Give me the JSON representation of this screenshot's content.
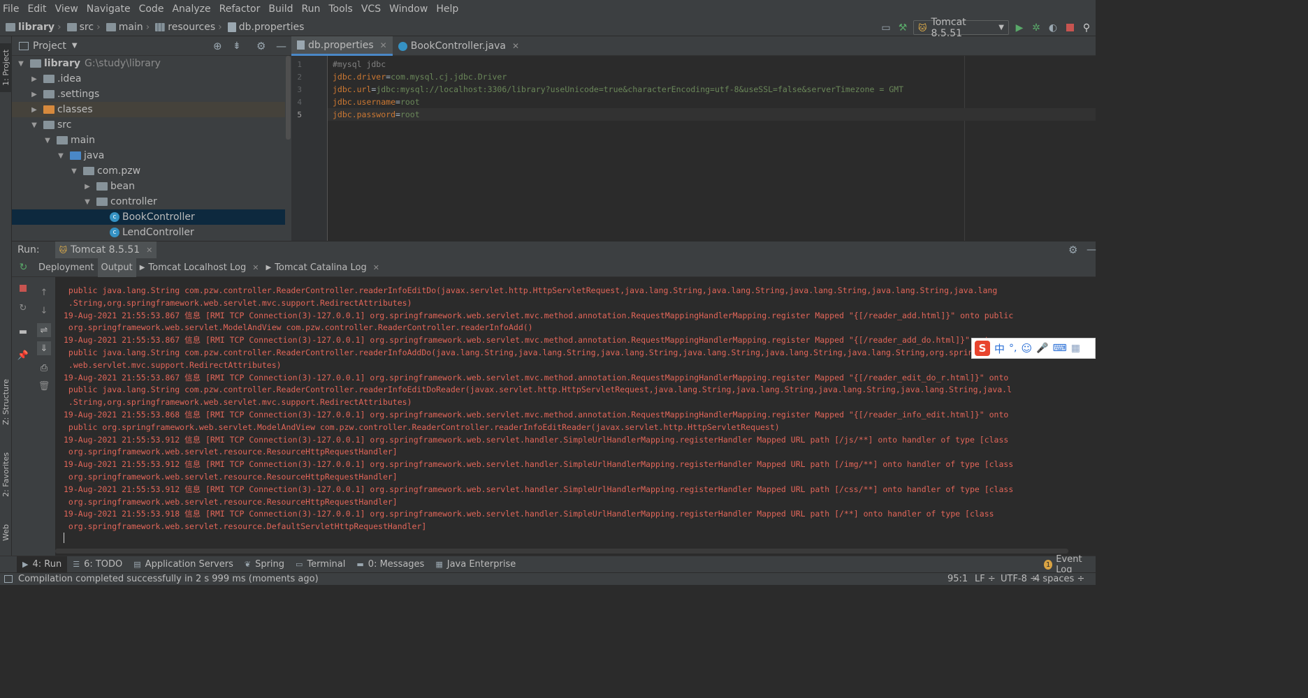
{
  "menu": [
    "File",
    "Edit",
    "View",
    "Navigate",
    "Code",
    "Analyze",
    "Refactor",
    "Build",
    "Run",
    "Tools",
    "VCS",
    "Window",
    "Help"
  ],
  "breadcrumb": [
    "library",
    "src",
    "main",
    "resources",
    "db.properties"
  ],
  "run_config": {
    "label": "Tomcat 8.5.51"
  },
  "side_tabs": {
    "project": "1: Project",
    "structure": "Z: Structure",
    "favorites": "2: Favorites",
    "web": "Web"
  },
  "project": {
    "title": "Project",
    "tree": [
      {
        "label": "library",
        "path": "G:\\study\\library",
        "kind": "module",
        "expanded": true,
        "indent": 0
      },
      {
        "label": ".idea",
        "kind": "folder",
        "expanded": false,
        "indent": 1
      },
      {
        "label": ".settings",
        "kind": "folder",
        "expanded": false,
        "indent": 1
      },
      {
        "label": "classes",
        "kind": "folder-excluded",
        "expanded": false,
        "indent": 1
      },
      {
        "label": "src",
        "kind": "folder",
        "expanded": true,
        "indent": 1
      },
      {
        "label": "main",
        "kind": "folder",
        "expanded": true,
        "indent": 2
      },
      {
        "label": "java",
        "kind": "folder-source",
        "expanded": true,
        "indent": 3
      },
      {
        "label": "com.pzw",
        "kind": "package",
        "expanded": true,
        "indent": 4
      },
      {
        "label": "bean",
        "kind": "package",
        "expanded": false,
        "indent": 5
      },
      {
        "label": "controller",
        "kind": "package",
        "expanded": true,
        "indent": 5
      },
      {
        "label": "BookController",
        "kind": "class",
        "selected": true,
        "indent": 6
      },
      {
        "label": "LendController",
        "kind": "class",
        "indent": 6
      }
    ]
  },
  "editor": {
    "tabs": [
      {
        "label": "db.properties",
        "active": true
      },
      {
        "label": "BookController.java",
        "active": false
      }
    ],
    "lines": [
      {
        "no": "1",
        "key": "#mysql jdbc",
        "value": "",
        "comment": true
      },
      {
        "no": "2",
        "key": "jdbc.driver",
        "value": "com.mysql.cj.jdbc.Driver"
      },
      {
        "no": "3",
        "key": "jdbc.url",
        "value": "jdbc:mysql://localhost:3306/library?useUnicode=true&characterEncoding=utf-8&useSSL=false&serverTimezone = GMT"
      },
      {
        "no": "4",
        "key": "jdbc.username",
        "value": "root"
      },
      {
        "no": "5",
        "key": "jdbc.password",
        "value": "root",
        "current": true
      }
    ]
  },
  "run": {
    "label": "Run:",
    "config_tab": "Tomcat 8.5.51",
    "tabs": [
      "Deployment",
      "Output",
      "Tomcat Localhost Log",
      "Tomcat Catalina Log"
    ],
    "active_tab": "Output",
    "console": [
      " public java.lang.String com.pzw.controller.ReaderController.readerInfoEditDo(javax.servlet.http.HttpServletRequest,java.lang.String,java.lang.String,java.lang.String,java.lang.String,java.lang",
      " .String,org.springframework.web.servlet.mvc.support.RedirectAttributes)",
      "19-Aug-2021 21:55:53.867 信息 [RMI TCP Connection(3)-127.0.0.1] org.springframework.web.servlet.mvc.method.annotation.RequestMappingHandlerMapping.register Mapped \"{[/reader_add.html]}\" onto public",
      " org.springframework.web.servlet.ModelAndView com.pzw.controller.ReaderController.readerInfoAdd()",
      "19-Aug-2021 21:55:53.867 信息 [RMI TCP Connection(3)-127.0.0.1] org.springframework.web.servlet.mvc.method.annotation.RequestMappingHandlerMapping.register Mapped \"{[/reader_add_do.html]}\" onto",
      " public java.lang.String com.pzw.controller.ReaderController.readerInfoAddDo(java.lang.String,java.lang.String,java.lang.String,java.lang.String,java.lang.String,java.lang.String,org.springframework",
      " .web.servlet.mvc.support.RedirectAttributes)",
      "19-Aug-2021 21:55:53.867 信息 [RMI TCP Connection(3)-127.0.0.1] org.springframework.web.servlet.mvc.method.annotation.RequestMappingHandlerMapping.register Mapped \"{[/reader_edit_do_r.html]}\" onto",
      " public java.lang.String com.pzw.controller.ReaderController.readerInfoEditDoReader(javax.servlet.http.HttpServletRequest,java.lang.String,java.lang.String,java.lang.String,java.lang.String,java.l",
      " .String,org.springframework.web.servlet.mvc.support.RedirectAttributes)",
      "19-Aug-2021 21:55:53.868 信息 [RMI TCP Connection(3)-127.0.0.1] org.springframework.web.servlet.mvc.method.annotation.RequestMappingHandlerMapping.register Mapped \"{[/reader_info_edit.html]}\" onto",
      " public org.springframework.web.servlet.ModelAndView com.pzw.controller.ReaderController.readerInfoEditReader(javax.servlet.http.HttpServletRequest)",
      "19-Aug-2021 21:55:53.912 信息 [RMI TCP Connection(3)-127.0.0.1] org.springframework.web.servlet.handler.SimpleUrlHandlerMapping.registerHandler Mapped URL path [/js/**] onto handler of type [class",
      " org.springframework.web.servlet.resource.ResourceHttpRequestHandler]",
      "19-Aug-2021 21:55:53.912 信息 [RMI TCP Connection(3)-127.0.0.1] org.springframework.web.servlet.handler.SimpleUrlHandlerMapping.registerHandler Mapped URL path [/img/**] onto handler of type [class",
      " org.springframework.web.servlet.resource.ResourceHttpRequestHandler]",
      "19-Aug-2021 21:55:53.912 信息 [RMI TCP Connection(3)-127.0.0.1] org.springframework.web.servlet.handler.SimpleUrlHandlerMapping.registerHandler Mapped URL path [/css/**] onto handler of type [class",
      " org.springframework.web.servlet.resource.ResourceHttpRequestHandler]",
      "19-Aug-2021 21:55:53.918 信息 [RMI TCP Connection(3)-127.0.0.1] org.springframework.web.servlet.handler.SimpleUrlHandlerMapping.registerHandler Mapped URL path [/**] onto handler of type [class",
      " org.springframework.web.servlet.resource.DefaultServletHttpRequestHandler]"
    ]
  },
  "bottom_tabs": [
    {
      "label": "4: Run",
      "active": true,
      "icon": "play-icon"
    },
    {
      "label": "6: TODO",
      "icon": "list-icon"
    },
    {
      "label": "Application Servers",
      "icon": "server-icon"
    },
    {
      "label": "Spring",
      "icon": "spring-leaf-icon"
    },
    {
      "label": "Terminal",
      "icon": "terminal-icon"
    },
    {
      "label": "0: Messages",
      "icon": "messages-icon"
    },
    {
      "label": "Java Enterprise",
      "icon": "java-enterprise-icon"
    }
  ],
  "event_log": {
    "count": "1",
    "label": "Event Log"
  },
  "status": {
    "message": "Compilation completed successfully in 2 s 999 ms (moments ago)",
    "position": "95:1",
    "line_sep": "LF ÷",
    "encoding": "UTF-8 ÷",
    "indent": "4 spaces ÷"
  },
  "ime": {
    "lang": "中"
  },
  "colors": {
    "bg": "#2b2b2b",
    "panel": "#3c3f41",
    "selection": "#0d293e",
    "error_text": "#e26659",
    "key": "#cc7832",
    "value": "#6a8759",
    "accent": "#4a88c7"
  }
}
